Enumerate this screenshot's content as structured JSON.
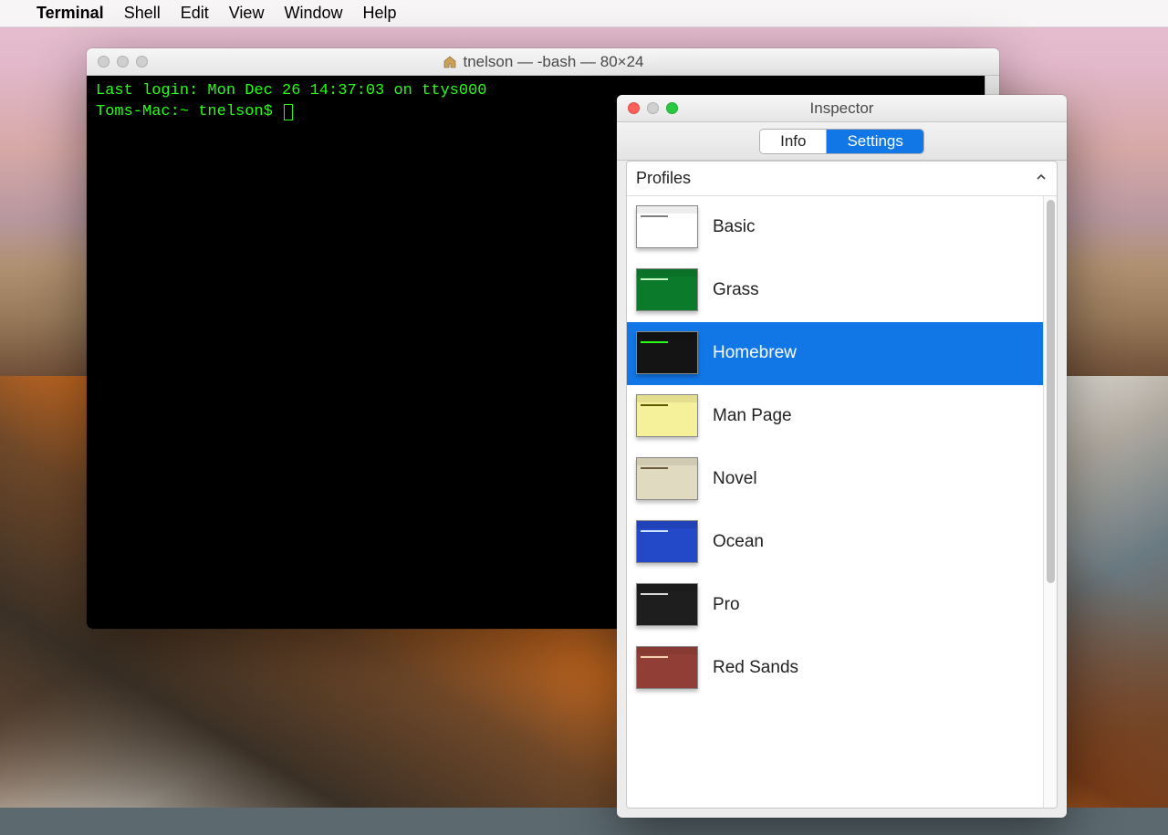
{
  "menubar": {
    "app": "Terminal",
    "items": [
      "Shell",
      "Edit",
      "View",
      "Window",
      "Help"
    ]
  },
  "terminal_window": {
    "title": "tnelson — -bash — 80×24",
    "lines": [
      "Last login: Mon Dec 26 14:37:03 on ttys000",
      "Toms-Mac:~ tnelson$ "
    ]
  },
  "inspector_window": {
    "title": "Inspector",
    "tabs": {
      "info": "Info",
      "settings": "Settings",
      "selected": "Settings"
    },
    "section_header": "Profiles",
    "selected_profile": "Homebrew",
    "profiles": [
      {
        "name": "Basic",
        "bg": "#ffffff",
        "accent": "#808080"
      },
      {
        "name": "Grass",
        "bg": "#0c7a2b",
        "accent": "#c8f7c5"
      },
      {
        "name": "Homebrew",
        "bg": "#141414",
        "accent": "#28fe14"
      },
      {
        "name": "Man Page",
        "bg": "#f5f09a",
        "accent": "#5a5a00"
      },
      {
        "name": "Novel",
        "bg": "#e0dac0",
        "accent": "#6b5b3e"
      },
      {
        "name": "Ocean",
        "bg": "#2348c8",
        "accent": "#cfe3ff"
      },
      {
        "name": "Pro",
        "bg": "#1e1e1e",
        "accent": "#dadada"
      },
      {
        "name": "Red Sands",
        "bg": "#913f36",
        "accent": "#f2d3b0"
      }
    ]
  },
  "colors": {
    "selection": "#1177e6",
    "terminal_text": "#28fe14"
  }
}
